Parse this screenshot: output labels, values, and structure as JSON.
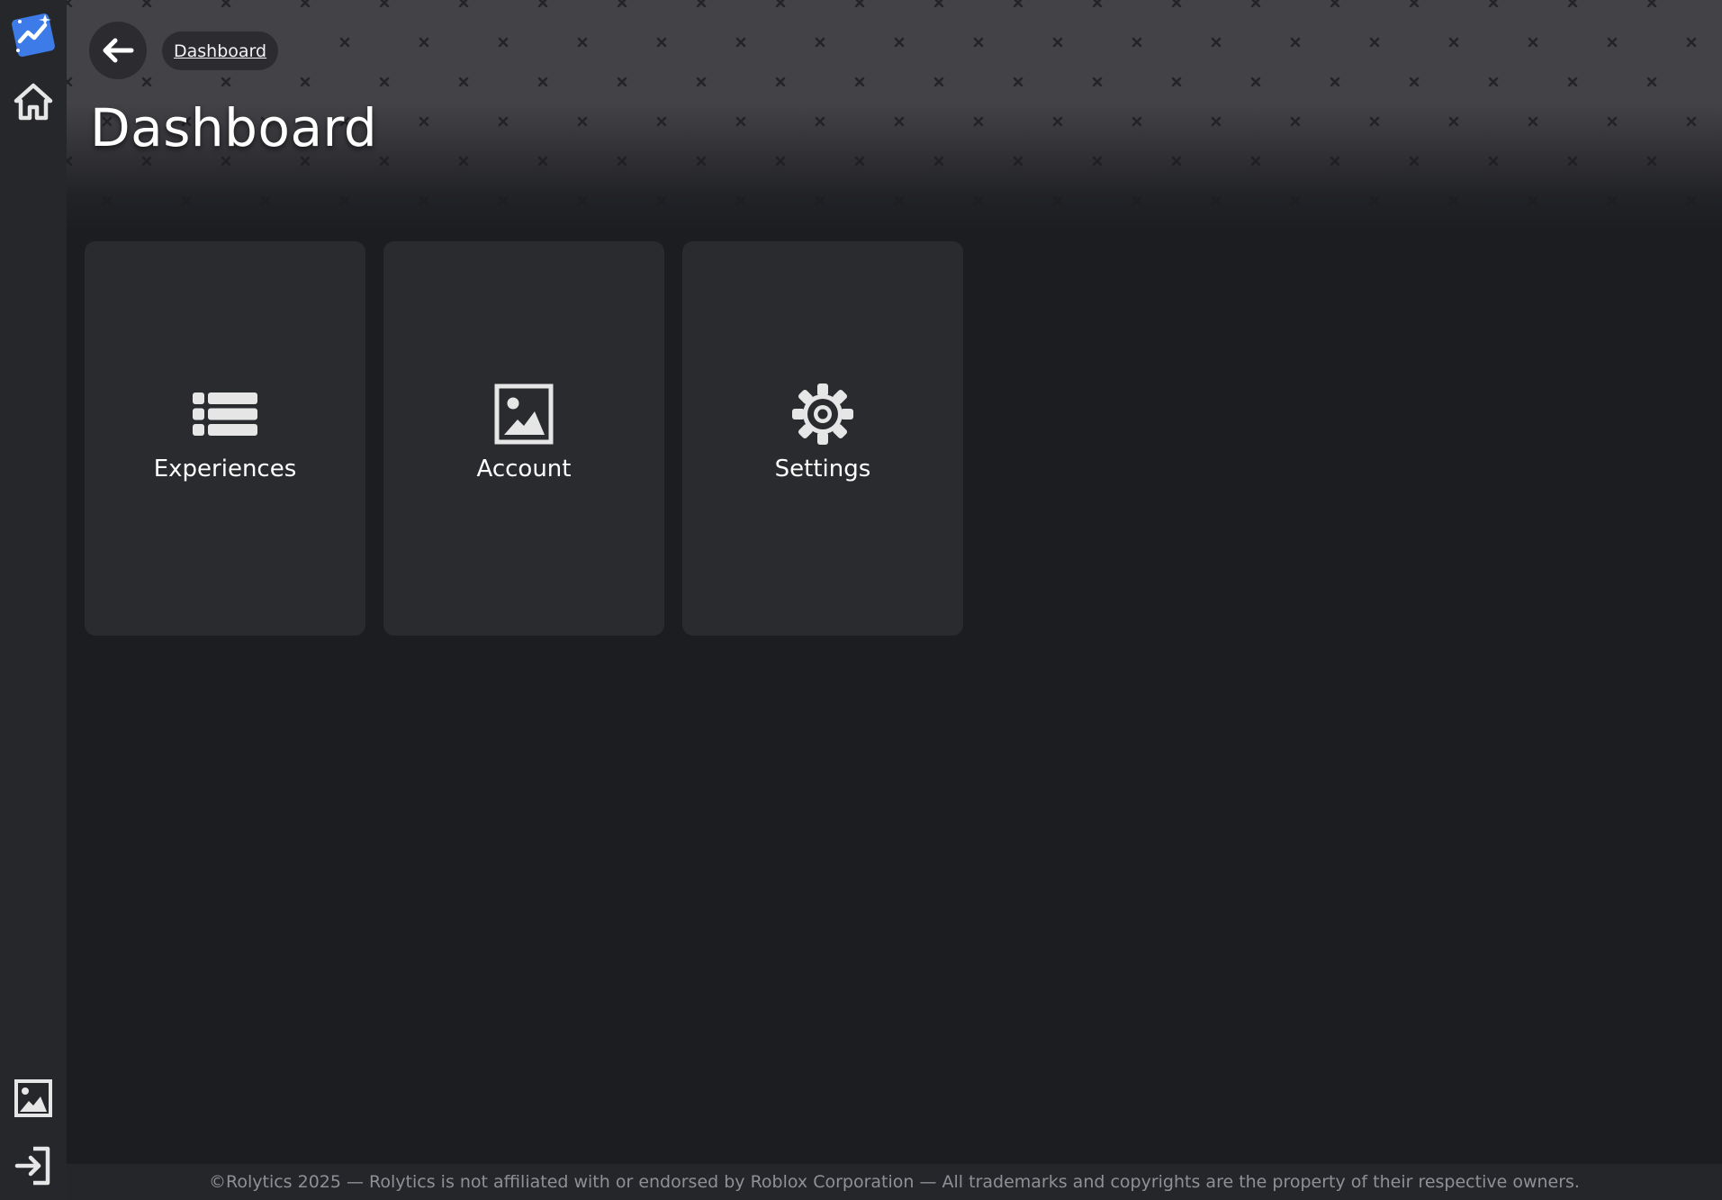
{
  "app": {
    "logo_name": "rolytics-logo",
    "accent_color": "#3d7be8"
  },
  "sidebar": {
    "top_items": [
      {
        "icon": "home-icon"
      }
    ],
    "bottom_items": [
      {
        "icon": "image-icon"
      },
      {
        "icon": "sign-in-icon"
      }
    ]
  },
  "header": {
    "breadcrumb": "Dashboard",
    "title": "Dashboard"
  },
  "tiles": [
    {
      "label": "Experiences",
      "icon": "list-icon"
    },
    {
      "label": "Account",
      "icon": "image-icon"
    },
    {
      "label": "Settings",
      "icon": "gear-icon"
    }
  ],
  "footer": {
    "text": "©Rolytics 2025 — Rolytics is not affiliated with or endorsed by Roblox Corporation — All trademarks and copyrights are the property of their respective owners."
  }
}
